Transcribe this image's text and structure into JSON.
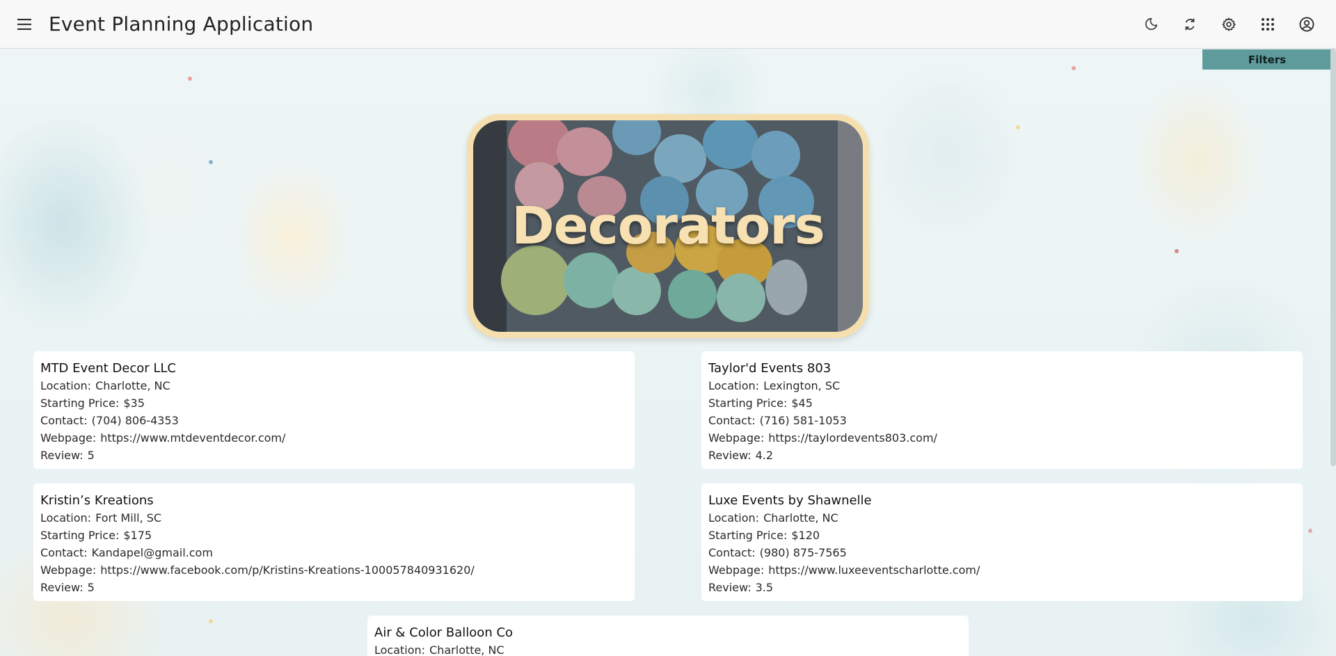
{
  "app": {
    "title": "Event Planning Application"
  },
  "topbar": {
    "menu_icon": "menu-icon",
    "actions": [
      {
        "name": "dark-mode-button",
        "icon": "moon-icon"
      },
      {
        "name": "refresh-button",
        "icon": "sync-icon"
      },
      {
        "name": "settings-button",
        "icon": "gear-icon"
      },
      {
        "name": "apps-button",
        "icon": "apps-grid-icon"
      },
      {
        "name": "account-button",
        "icon": "account-circle-icon"
      }
    ]
  },
  "filters": {
    "label": "Filters"
  },
  "banner": {
    "title": "Decorators"
  },
  "labels": {
    "location": "Location:",
    "price": "Starting Price:",
    "contact": "Contact:",
    "webpage": "Webpage:",
    "review": "Review:"
  },
  "vendors": [
    {
      "name": "MTD Event Decor LLC",
      "location": "Charlotte, NC",
      "price": "$35",
      "contact": "(704) 806-4353",
      "webpage": "https://www.mtdeventdecor.com/",
      "review": "5"
    },
    {
      "name": "Taylor'd Events 803",
      "location": "Lexington, SC",
      "price": "$45",
      "contact": "(716) 581-1053",
      "webpage": "https://taylordevents803.com/",
      "review": "4.2"
    },
    {
      "name": "Kristin’s Kreations",
      "location": "Fort Mill, SC",
      "price": "$175",
      "contact": "Kandapel@gmail.com",
      "webpage": "https://www.facebook.com/p/Kristins-Kreations-100057840931620/",
      "review": "5"
    },
    {
      "name": "Luxe Events by Shawnelle",
      "location": "Charlotte, NC",
      "price": "$120",
      "contact": "(980) 875-7565",
      "webpage": "https://www.luxeeventscharlotte.com/",
      "review": "3.5"
    },
    {
      "name": "Air & Color Balloon Co",
      "location": "Charlotte, NC"
    }
  ],
  "colors": {
    "accent": "#5f9a9d",
    "banner_border": "#f6dfae",
    "banner_text": "#f7e0b2"
  }
}
